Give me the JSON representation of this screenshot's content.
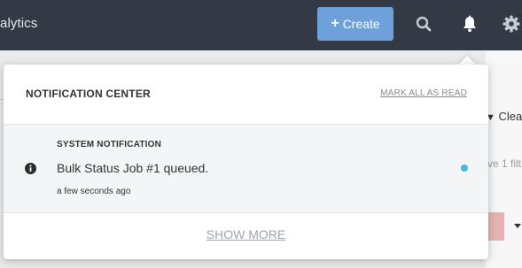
{
  "app": {
    "title_fragment": "alytics"
  },
  "topbar": {
    "create_label": "Create",
    "icons": [
      "search-icon",
      "bell-icon",
      "gear-icon"
    ]
  },
  "background": {
    "clear_label": "Clear",
    "filter_text": "ve 1 filt"
  },
  "notification_center": {
    "title": "NOTIFICATION CENTER",
    "mark_all_read": "MARK ALL AS READ",
    "items": [
      {
        "type": "SYSTEM NOTIFICATION",
        "message": "Bulk Status Job #1 queued.",
        "time": "a few seconds ago",
        "icon": "info-icon",
        "unread": true
      }
    ],
    "show_more": "SHOW MORE"
  },
  "colors": {
    "topbar_bg": "#333a45",
    "create_button": "#6ea1d9",
    "unread_dot": "#4db4e6",
    "row_bg": "#f4f5f7"
  }
}
